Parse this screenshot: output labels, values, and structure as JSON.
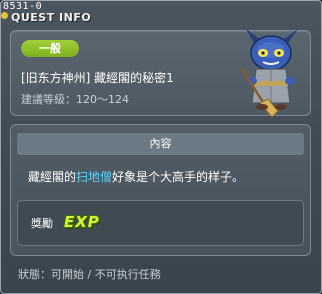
{
  "quest_id": "8531-0",
  "window_title": "QUEST INFO",
  "grade_badge": "一般",
  "quest_name": "[旧东方神州] 藏經閣的秘密1",
  "level_requirement": "建議等級：120～124",
  "content_header": "內容",
  "description": {
    "before": "藏經閣的",
    "highlight": "扫地僧",
    "after": "好象是个大高手的样子。"
  },
  "reward": {
    "label": "獎勵",
    "icon_text": "EXP"
  },
  "status": "狀態：可開始 / 不可执行任務",
  "colors": {
    "highlight": "#56d6ff",
    "badge": "#8fbf28",
    "exp": "#d9f23a"
  },
  "icons": {
    "npc": "blue-horned-monk-sweeping-npc-icon",
    "exp": "exp-icon"
  }
}
